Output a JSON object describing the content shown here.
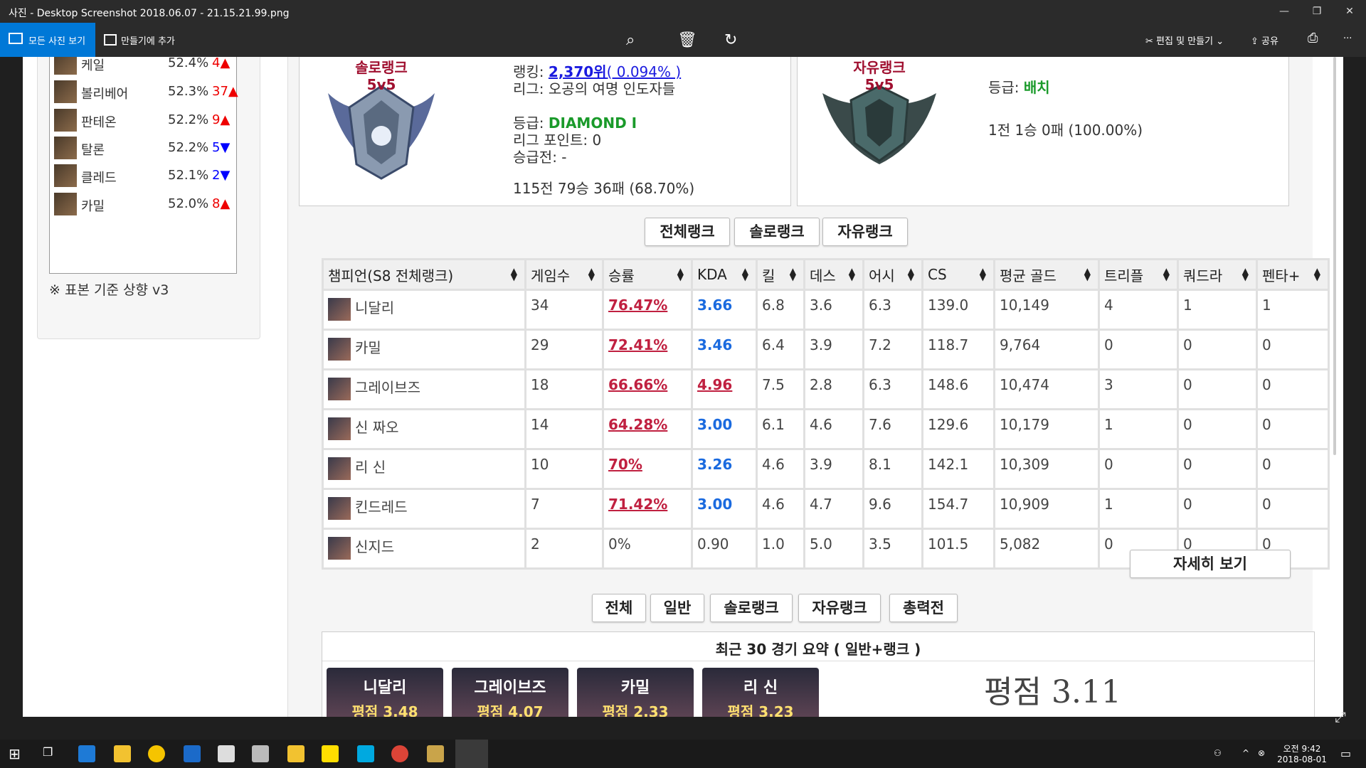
{
  "window": {
    "title": "사진 - Desktop Screenshot 2018.06.07 - 21.15.21.99.png",
    "controls": [
      "—",
      "❐",
      "✕"
    ]
  },
  "toolbar": {
    "all_photos": "모든 사진 보기",
    "add_to_creation": "만들기에 추가",
    "edit_create": "편집 및 만들기",
    "share": "공유",
    "more": "···"
  },
  "sidebar": {
    "champions": [
      {
        "name": "케일",
        "pct": "52.4%",
        "change": "4▲",
        "dir": "up"
      },
      {
        "name": "볼리베어",
        "pct": "52.3%",
        "change": "37▲",
        "dir": "up"
      },
      {
        "name": "판테온",
        "pct": "52.2%",
        "change": "9▲",
        "dir": "up"
      },
      {
        "name": "탈론",
        "pct": "52.2%",
        "change": "5▼",
        "dir": "down"
      },
      {
        "name": "클레드",
        "pct": "52.1%",
        "change": "2▼",
        "dir": "down"
      },
      {
        "name": "카밀",
        "pct": "52.0%",
        "change": "8▲",
        "dir": "up"
      }
    ],
    "note": "※ 표본 기준 상향 v3"
  },
  "solo_rank": {
    "emblem_title": "솔로랭크",
    "emblem_mode": "5v5",
    "ranking_label": "랭킹:",
    "ranking_value": "2,370위",
    "ranking_pct": "( 0.094% )",
    "league": "리그: 오공의 여명 인도자들",
    "tier_label": "등급:",
    "tier_value": "DIAMOND I",
    "league_points": "리그 포인트: 0",
    "promo": "승급전: -",
    "record": "115전 79승 36패 (68.70%)"
  },
  "flex_rank": {
    "emblem_title": "자유랭크",
    "emblem_mode": "5v5",
    "tier_label": "등급:",
    "tier_value": "배치",
    "record": "1전 1승 0패 (100.00%)"
  },
  "rank_tabs": [
    "전체랭크",
    "솔로랭크",
    "자유랭크"
  ],
  "table": {
    "headers": [
      "챔피언(S8 전체랭크)",
      "게임수",
      "승률",
      "KDA",
      "킬",
      "데스",
      "어시",
      "CS",
      "평균 골드",
      "트리플",
      "쿼드라",
      "펜타+"
    ],
    "rows": [
      {
        "champ": "니달리",
        "games": "34",
        "wr": "76.47%",
        "kda": "3.66",
        "k": "6.8",
        "d": "3.6",
        "a": "6.3",
        "cs": "139.0",
        "gold": "10,149",
        "triple": "4",
        "quadra": "1",
        "penta": "1"
      },
      {
        "champ": "카밀",
        "games": "29",
        "wr": "72.41%",
        "kda": "3.46",
        "k": "6.4",
        "d": "3.9",
        "a": "7.2",
        "cs": "118.7",
        "gold": "9,764",
        "triple": "0",
        "quadra": "0",
        "penta": "0"
      },
      {
        "champ": "그레이브즈",
        "games": "18",
        "wr": "66.66%",
        "kda": "4.96",
        "k": "7.5",
        "d": "2.8",
        "a": "6.3",
        "cs": "148.6",
        "gold": "10,474",
        "triple": "3",
        "quadra": "0",
        "penta": "0"
      },
      {
        "champ": "신 짜오",
        "games": "14",
        "wr": "64.28%",
        "kda": "3.00",
        "k": "6.1",
        "d": "4.6",
        "a": "7.6",
        "cs": "129.6",
        "gold": "10,179",
        "triple": "1",
        "quadra": "0",
        "penta": "0"
      },
      {
        "champ": "리 신",
        "games": "10",
        "wr": "70%",
        "kda": "3.26",
        "k": "4.6",
        "d": "3.9",
        "a": "8.1",
        "cs": "142.1",
        "gold": "10,309",
        "triple": "0",
        "quadra": "0",
        "penta": "0"
      },
      {
        "champ": "킨드레드",
        "games": "7",
        "wr": "71.42%",
        "kda": "3.00",
        "k": "4.6",
        "d": "4.7",
        "a": "9.6",
        "cs": "154.7",
        "gold": "10,909",
        "triple": "1",
        "quadra": "0",
        "penta": "0"
      },
      {
        "champ": "신지드",
        "games": "2",
        "wr": "0%",
        "kda": "0.90",
        "k": "1.0",
        "d": "5.0",
        "a": "3.5",
        "cs": "101.5",
        "gold": "5,082",
        "triple": "0",
        "quadra": "0",
        "penta": "0"
      }
    ]
  },
  "detail_button": "자세히 보기",
  "match_tabs": [
    "전체",
    "일반",
    "솔로랭크",
    "자유랭크",
    "총력전"
  ],
  "summary": {
    "title": "최근 30 경기 요약 ( 일반+랭크 )",
    "cards": [
      {
        "name": "니달리",
        "score": "평점 3.48"
      },
      {
        "name": "그레이브즈",
        "score": "평점 4.07"
      },
      {
        "name": "카밀",
        "score": "평점 2.33"
      },
      {
        "name": "리 신",
        "score": "평점 3.23"
      }
    ],
    "overall": "평점 3.11"
  },
  "taskbar": {
    "time": "오전 9:42",
    "date": "2018-08-01"
  }
}
